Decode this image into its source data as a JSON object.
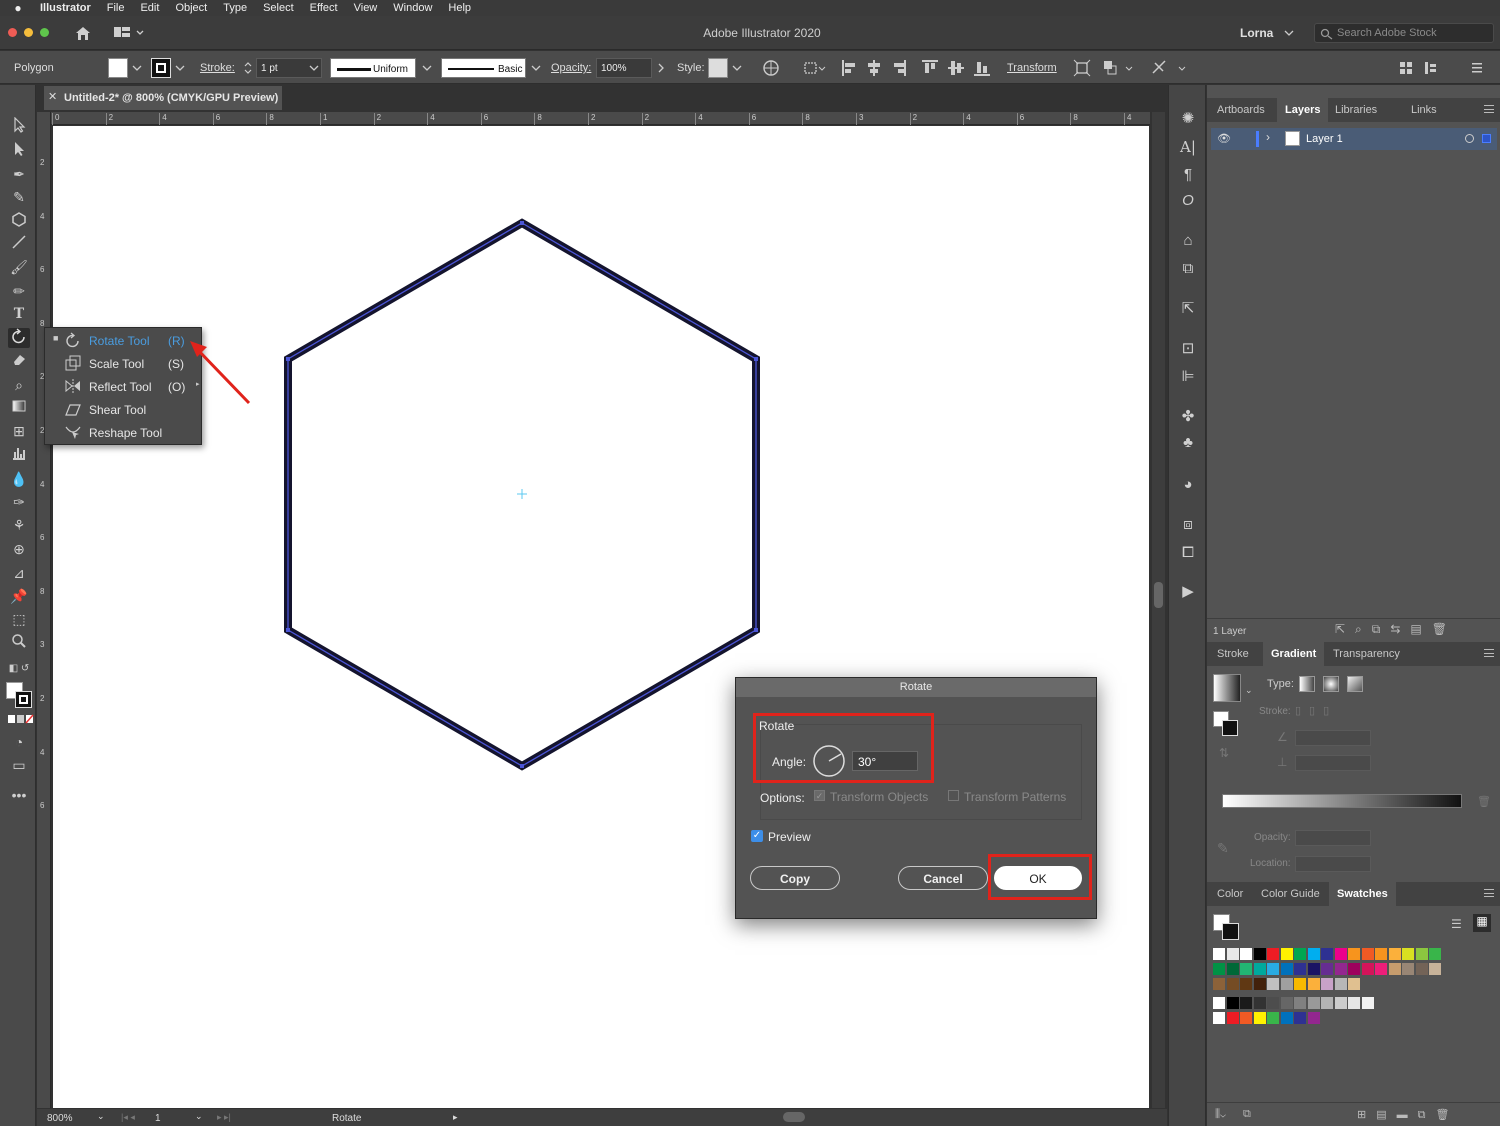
{
  "menubar": {
    "app": "Illustrator",
    "items": [
      "File",
      "Edit",
      "Object",
      "Type",
      "Select",
      "Effect",
      "View",
      "Window",
      "Help"
    ]
  },
  "titlebar": {
    "title": "Adobe Illustrator 2020",
    "user": "Lorna",
    "search_placeholder": "Search Adobe Stock"
  },
  "controlbar": {
    "object_type": "Polygon",
    "stroke_label": "Stroke:",
    "stroke_weight": "1 pt",
    "profile": "Uniform",
    "brush": "Basic",
    "opacity_label": "Opacity:",
    "opacity": "100%",
    "style_label": "Style:",
    "transform_label": "Transform"
  },
  "document": {
    "tab_title": "Untitled-2* @ 800% (CMYK/GPU Preview)",
    "zoom": "800%",
    "artboard_number": "1",
    "status": "Rotate"
  },
  "ruler_top": [
    "0",
    "2",
    "4",
    "6",
    "8",
    "1",
    "2",
    "4",
    "6",
    "8",
    "2",
    "2",
    "4",
    "6",
    "8",
    "3",
    "2",
    "4",
    "6",
    "8",
    "4"
  ],
  "ruler_left": [
    "2",
    "4",
    "6",
    "8",
    "2",
    "2",
    "4",
    "6",
    "8",
    "3",
    "2",
    "4",
    "6"
  ],
  "flyout": {
    "items": [
      {
        "label": "Rotate Tool",
        "shortcut": "(R)",
        "icon": "rotate-icon"
      },
      {
        "label": "Scale Tool",
        "shortcut": "(S)",
        "icon": "scale-icon"
      },
      {
        "label": "Reflect Tool",
        "shortcut": "(O)",
        "icon": "reflect-icon"
      },
      {
        "label": "Shear Tool",
        "shortcut": "",
        "icon": "shear-icon"
      },
      {
        "label": "Reshape Tool",
        "shortcut": "",
        "icon": "reshape-icon"
      }
    ]
  },
  "layers_panel": {
    "tabs": [
      "Artboards",
      "Layers",
      "Libraries",
      "Links"
    ],
    "active_tab": "Layers",
    "layer_name": "Layer 1",
    "footer_count": "1 Layer"
  },
  "gradient_panel": {
    "tabs": [
      "Stroke",
      "Gradient",
      "Transparency"
    ],
    "active_tab": "Gradient",
    "type_label": "Type:",
    "stroke_label": "Stroke:",
    "opacity_label": "Opacity:",
    "location_label": "Location:"
  },
  "swatches_panel": {
    "tabs": [
      "Color",
      "Color Guide",
      "Swatches"
    ],
    "active_tab": "Swatches"
  },
  "rotate_dialog": {
    "title": "Rotate",
    "section_label": "Rotate",
    "angle_label": "Angle:",
    "angle_value": "30°",
    "options_label": "Options:",
    "transform_objects": "Transform Objects",
    "transform_patterns": "Transform Patterns",
    "preview_label": "Preview",
    "copy_label": "Copy",
    "cancel_label": "Cancel",
    "ok_label": "OK"
  },
  "colors": {
    "accent_blue": "#4a9de0",
    "annotation_red": "#e0231b",
    "hexagon_stroke": "#14142e",
    "path_highlight": "#4b55d6"
  }
}
